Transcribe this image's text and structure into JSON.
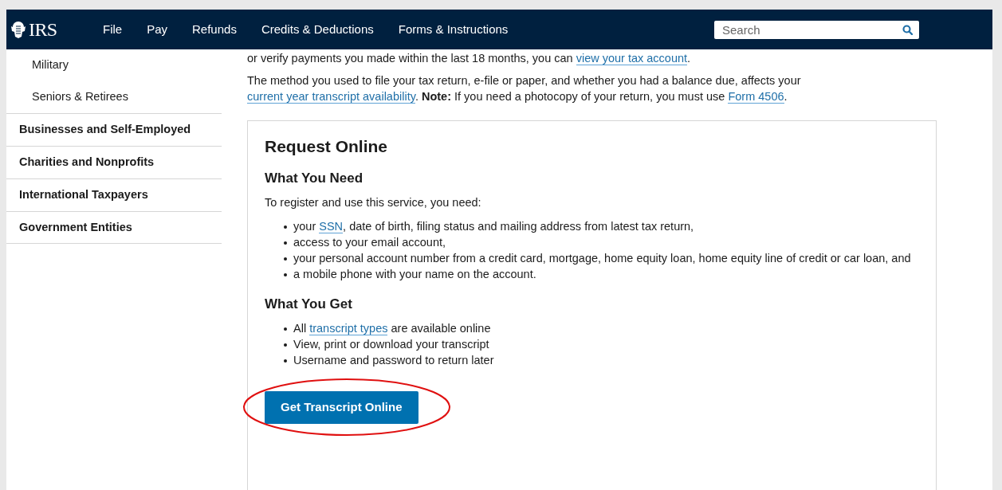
{
  "header": {
    "logo": "IRS",
    "nav": [
      "File",
      "Pay",
      "Refunds",
      "Credits & Deductions",
      "Forms & Instructions"
    ],
    "search": {
      "placeholder": "Search"
    }
  },
  "sidebar": {
    "items": [
      {
        "label": "Military",
        "kind": "sub"
      },
      {
        "label": "Seniors & Retirees",
        "kind": "sub"
      },
      {
        "label": "Businesses and Self-Employed",
        "kind": "section"
      },
      {
        "label": "Charities and Nonprofits",
        "kind": "section"
      },
      {
        "label": "International Taxpayers",
        "kind": "section"
      },
      {
        "label": "Government Entities",
        "kind": "section"
      }
    ]
  },
  "intro": [
    [
      {
        "kind": "text",
        "text": "or verify payments you made within the last 18 months, you can "
      },
      {
        "kind": "link",
        "text": "view your tax account"
      },
      {
        "kind": "text",
        "text": "."
      }
    ],
    [
      {
        "kind": "text",
        "text": "The method you used to file your tax return, e-file or paper, and whether you had a balance due, affects your "
      },
      {
        "kind": "link",
        "text": "current year transcript availability"
      },
      {
        "kind": "text",
        "text": ". "
      },
      {
        "kind": "bold",
        "text": "Note:"
      },
      {
        "kind": "text",
        "text": " If you need a photocopy of your return, you must use "
      },
      {
        "kind": "link",
        "text": "Form 4506"
      },
      {
        "kind": "text",
        "text": "."
      }
    ]
  ],
  "card": {
    "title": "Request Online",
    "need": {
      "heading": "What You Need",
      "lead": "To register and use this service, you need:",
      "bullets": [
        [
          {
            "kind": "text",
            "text": "your "
          },
          {
            "kind": "link",
            "text": "SSN"
          },
          {
            "kind": "text",
            "text": ", date of birth, filing status and mailing address from latest tax return,"
          }
        ],
        [
          {
            "kind": "text",
            "text": "access to your email account,"
          }
        ],
        [
          {
            "kind": "text",
            "text": "your personal account number from a credit card, mortgage, home equity loan, home equity line of credit or car loan, and"
          }
        ],
        [
          {
            "kind": "text",
            "text": "a mobile phone with your name on the account."
          }
        ]
      ]
    },
    "get": {
      "heading": "What You Get",
      "bullets": [
        [
          {
            "kind": "text",
            "text": "All "
          },
          {
            "kind": "link",
            "text": "transcript types"
          },
          {
            "kind": "text",
            "text": " are available online"
          }
        ],
        [
          {
            "kind": "text",
            "text": "View, print or download your transcript"
          }
        ],
        [
          {
            "kind": "text",
            "text": "Username and password to return later"
          }
        ]
      ]
    },
    "button": "Get Transcript Online"
  }
}
